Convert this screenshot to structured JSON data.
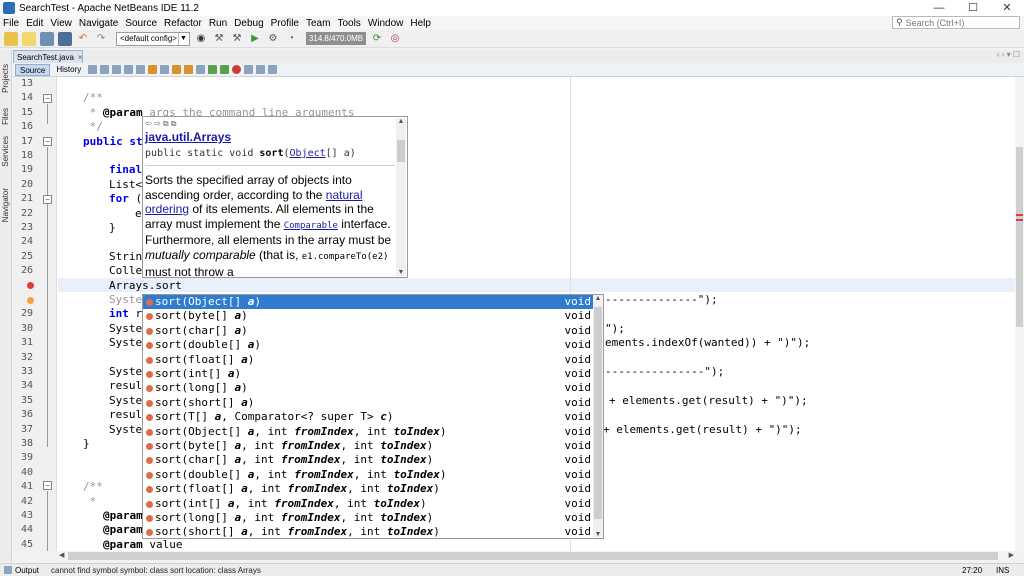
{
  "window": {
    "title": "SearchTest - Apache NetBeans IDE 11.2",
    "controls": [
      "—",
      "☐",
      "✕"
    ]
  },
  "menu": [
    "File",
    "Edit",
    "View",
    "Navigate",
    "Source",
    "Refactor",
    "Run",
    "Debug",
    "Profile",
    "Team",
    "Tools",
    "Window",
    "Help"
  ],
  "search": {
    "placeholder": "Search (Ctrl+I)"
  },
  "toolbar": {
    "config": "<default config>",
    "memory": "314.8/470.0MB"
  },
  "side_tabs": [
    "Projects",
    "Files",
    "Services",
    "Navigator"
  ],
  "editor_tab": {
    "label": "SearchTest.java",
    "close": "×"
  },
  "editor_view_tabs": [
    "Source",
    "History"
  ],
  "line_numbers": [
    "13",
    "14",
    "15",
    "16",
    "17",
    "18",
    "19",
    "20",
    "21",
    "22",
    "23",
    "24",
    "25",
    "26",
    "27",
    "28",
    "29",
    "30",
    "31",
    "32",
    "33",
    "34",
    "35",
    "36",
    "37",
    "38",
    "39",
    "40",
    "41",
    "42",
    "43",
    "44",
    "45"
  ],
  "code": {
    "l14": "/**",
    "l15_pre": " * ",
    "l15_tag": "@param",
    "l15_rest": " args the command line arguments",
    "l16": " */",
    "l17_kw": "public",
    "l17_rest": " st",
    "l19_kw": "final",
    "l20": "List<",
    "l21_kw": "for",
    "l21_rest": " (",
    "l22": "e",
    "l23": "}",
    "l25": "Strin",
    "l26": "Colle",
    "l27": "Arrays.sort",
    "l28": "Syste",
    "l29_kw": "int",
    "l29_rest": " r",
    "l30": "Syste",
    "l31": "Syste",
    "l33": "Syste",
    "l34": "resul",
    "l35": "Syste",
    "l36": "resul",
    "l37": "Syste",
    "l38": "}",
    "l41": "/**",
    "l42": " *",
    "l43_tag": "@param",
    "l44_tag": "@param",
    "l45_tag": "@param",
    "l45_rest": " value",
    "r28": "--------------\");",
    "r30": "\");",
    "r31": "ements.indexOf(wanted)) + \")\");",
    "r33": "---------------\");",
    "r35": "+ elements.get(result) + \")\");",
    "r37": "+ elements.get(result) + \")\");"
  },
  "doc_popup": {
    "nav": "⇦ ⇨ ⧉ ⧉",
    "class_name": "java.util.Arrays",
    "sig_pre": "public static void ",
    "sig_name": "sort",
    "sig_open": "(",
    "sig_type": "Object",
    "sig_rest": "[] a)",
    "d1": "Sorts the specified array of objects into ascending order, according to the ",
    "d1_link": "natural ordering",
    "d2": " of its elements. All elements in the array must implement the ",
    "d2_code": "Comparable",
    "d3": " interface. Furthermore, all elements in the array must be ",
    "d3_em": "mutually comparable",
    "d4": " (that is, ",
    "d4_code": "e1.compareTo(e2)",
    "d5": " must not throw a"
  },
  "completion": {
    "items": [
      {
        "name": "sort",
        "params": [
          [
            "Object[] ",
            "a"
          ]
        ],
        "ret": "void"
      },
      {
        "name": "sort",
        "params": [
          [
            "byte[] ",
            "a"
          ]
        ],
        "ret": "void"
      },
      {
        "name": "sort",
        "params": [
          [
            "char[] ",
            "a"
          ]
        ],
        "ret": "void"
      },
      {
        "name": "sort",
        "params": [
          [
            "double[] ",
            "a"
          ]
        ],
        "ret": "void"
      },
      {
        "name": "sort",
        "params": [
          [
            "float[] ",
            "a"
          ]
        ],
        "ret": "void"
      },
      {
        "name": "sort",
        "params": [
          [
            "int[] ",
            "a"
          ]
        ],
        "ret": "void"
      },
      {
        "name": "sort",
        "params": [
          [
            "long[] ",
            "a"
          ]
        ],
        "ret": "void"
      },
      {
        "name": "sort",
        "params": [
          [
            "short[] ",
            "a"
          ]
        ],
        "ret": "void"
      },
      {
        "name": "sort",
        "params": [
          [
            "T[] ",
            "a"
          ],
          [
            "Comparator<? super T> ",
            "c"
          ]
        ],
        "ret": "void"
      },
      {
        "name": "sort",
        "params": [
          [
            "Object[] ",
            "a"
          ],
          [
            "int ",
            "fromIndex"
          ],
          [
            "int ",
            "toIndex"
          ]
        ],
        "ret": "void"
      },
      {
        "name": "sort",
        "params": [
          [
            "byte[] ",
            "a"
          ],
          [
            "int ",
            "fromIndex"
          ],
          [
            "int ",
            "toIndex"
          ]
        ],
        "ret": "void"
      },
      {
        "name": "sort",
        "params": [
          [
            "char[] ",
            "a"
          ],
          [
            "int ",
            "fromIndex"
          ],
          [
            "int ",
            "toIndex"
          ]
        ],
        "ret": "void"
      },
      {
        "name": "sort",
        "params": [
          [
            "double[] ",
            "a"
          ],
          [
            "int ",
            "fromIndex"
          ],
          [
            "int ",
            "toIndex"
          ]
        ],
        "ret": "void"
      },
      {
        "name": "sort",
        "params": [
          [
            "float[] ",
            "a"
          ],
          [
            "int ",
            "fromIndex"
          ],
          [
            "int ",
            "toIndex"
          ]
        ],
        "ret": "void"
      },
      {
        "name": "sort",
        "params": [
          [
            "int[] ",
            "a"
          ],
          [
            "int ",
            "fromIndex"
          ],
          [
            "int ",
            "toIndex"
          ]
        ],
        "ret": "void"
      },
      {
        "name": "sort",
        "params": [
          [
            "long[] ",
            "a"
          ],
          [
            "int ",
            "fromIndex"
          ],
          [
            "int ",
            "toIndex"
          ]
        ],
        "ret": "void"
      },
      {
        "name": "sort",
        "params": [
          [
            "short[] ",
            "a"
          ],
          [
            "int ",
            "fromIndex"
          ],
          [
            "int ",
            "toIndex"
          ]
        ],
        "ret": "void"
      }
    ]
  },
  "status": {
    "output_label": "Output",
    "message": "cannot find symbol   symbol:   class sort   location: class Arrays",
    "position": "27:20",
    "mode": "INS"
  }
}
